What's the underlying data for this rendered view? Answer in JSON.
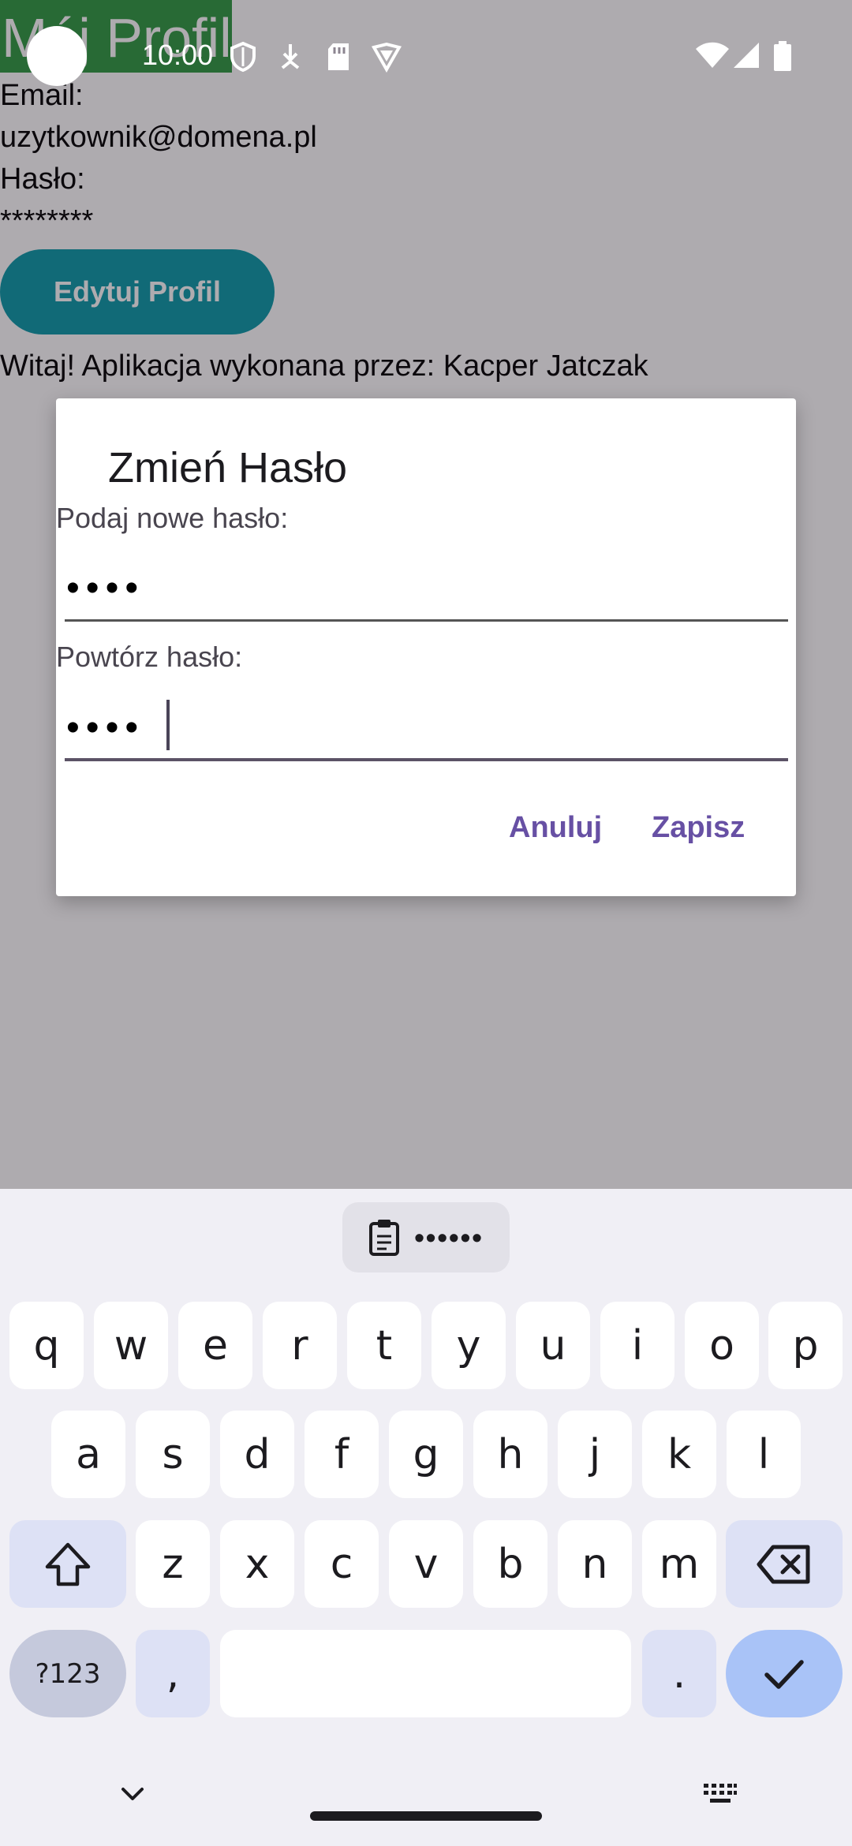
{
  "app": {
    "title": "Mój Profil",
    "email_label": "Email:",
    "email_value": "uzytkownik@domena.pl",
    "password_label": "Hasło:",
    "password_value": "********",
    "edit_button": "Edytuj Profil",
    "welcome_text": "Witaj! Aplikacja wykonana przez: Kacper Jatczak"
  },
  "status_bar": {
    "time": "10:00"
  },
  "dialog": {
    "title": "Zmień Hasło",
    "new_password_label": "Podaj nowe hasło:",
    "new_password_value": "••••",
    "repeat_password_label": "Powtórz hasło:",
    "repeat_password_value": "••••",
    "cancel_button": "Anuluj",
    "save_button": "Zapisz"
  },
  "keyboard": {
    "clipboard_chip": "••••••",
    "row1": [
      "q",
      "w",
      "e",
      "r",
      "t",
      "y",
      "u",
      "i",
      "o",
      "p"
    ],
    "row2": [
      "a",
      "s",
      "d",
      "f",
      "g",
      "h",
      "j",
      "k",
      "l"
    ],
    "row3": [
      "z",
      "x",
      "c",
      "v",
      "b",
      "n",
      "m"
    ],
    "symbols_key": "?123",
    "comma_key": ",",
    "period_key": "."
  },
  "colors": {
    "title_bar": "#2e9a40",
    "edit_button": "#0a9aa8",
    "dialog_accent": "#6750a4",
    "enter_key": "#a9c3f7"
  }
}
